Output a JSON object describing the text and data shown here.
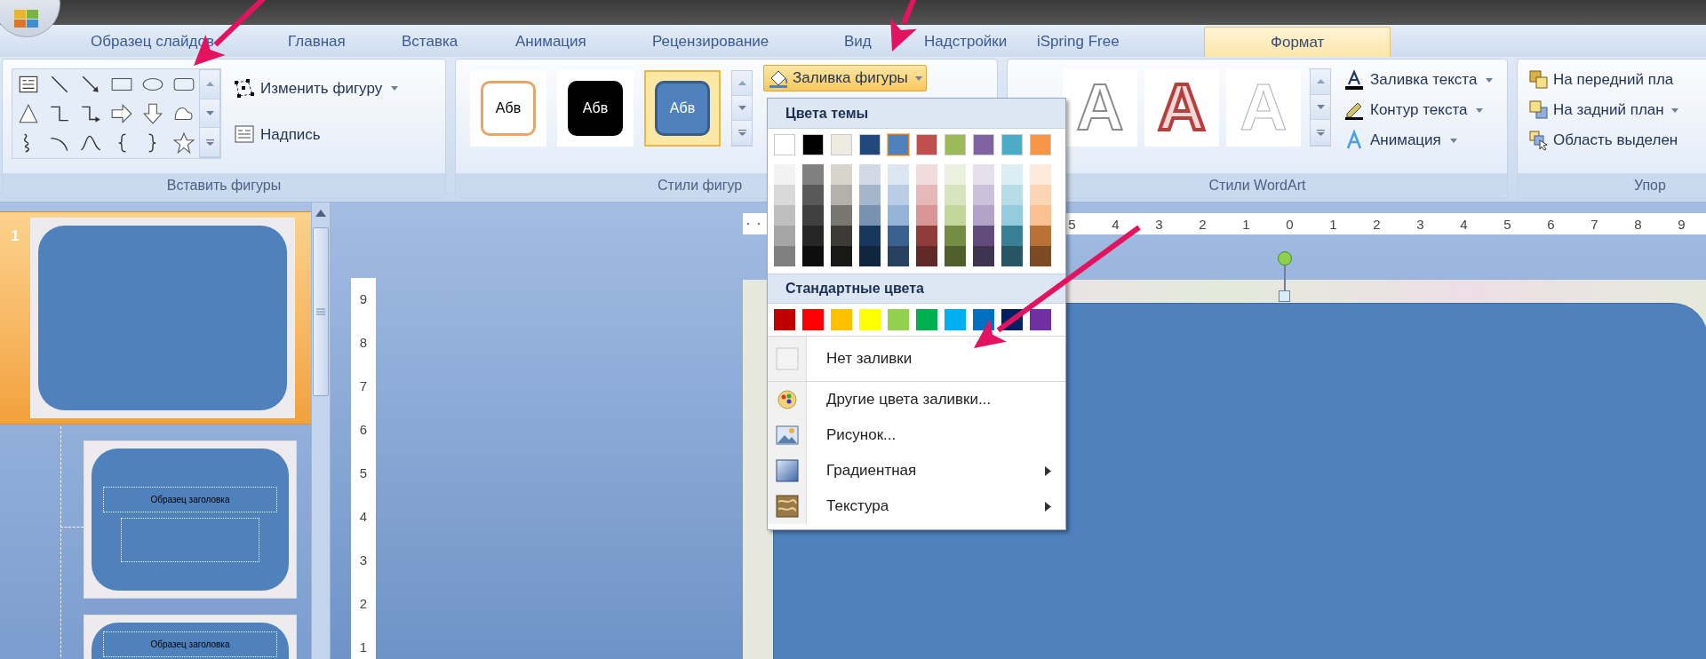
{
  "tabs": [
    {
      "label": "Образец слайдов",
      "selected": false
    },
    {
      "label": "Главная",
      "selected": false
    },
    {
      "label": "Вставка",
      "selected": false
    },
    {
      "label": "Анимация",
      "selected": false
    },
    {
      "label": "Рецензирование",
      "selected": false
    },
    {
      "label": "Вид",
      "selected": false
    },
    {
      "label": "Надстройки",
      "selected": false
    },
    {
      "label": "iSpring Free",
      "selected": false
    },
    {
      "label": "Формат",
      "selected": true
    }
  ],
  "insert_shapes": {
    "label": "Вставить фигуры",
    "buttons": [
      {
        "label": "Изменить фигуру",
        "kind": "edit-shape",
        "dropdown": true
      },
      {
        "label": "Надпись",
        "kind": "text-box",
        "dropdown": false
      }
    ]
  },
  "shape_styles": {
    "label": "Стили фигур",
    "styles": [
      {
        "text": "Абв",
        "kind": "outline",
        "selected": false
      },
      {
        "text": "Абв",
        "kind": "dark",
        "selected": false
      },
      {
        "text": "Абв",
        "kind": "blue",
        "selected": true
      }
    ],
    "fill_button": {
      "label": "Заливка фигуры",
      "open": true
    }
  },
  "wordart": {
    "label": "Стили WordArt",
    "styles": [
      {
        "text": "A",
        "kind": "outline"
      },
      {
        "text": "A",
        "kind": "red"
      },
      {
        "text": "A",
        "kind": "white"
      }
    ],
    "buttons": [
      {
        "label": "Заливка текста",
        "kind": "text-fill"
      },
      {
        "label": "Контур текста",
        "kind": "text-outline"
      },
      {
        "label": "Анимация",
        "kind": "animation"
      }
    ]
  },
  "arrange": {
    "label": "Упор",
    "buttons": [
      {
        "label": "На передний пла",
        "kind": "front",
        "dropdown": false
      },
      {
        "label": "На задний план",
        "kind": "back",
        "dropdown": true
      },
      {
        "label": "Область выделен",
        "kind": "selection",
        "dropdown": false
      }
    ]
  },
  "fill_menu": {
    "theme_header": "Цвета темы",
    "theme_colors": [
      {
        "color": "#ffffff",
        "selected": false
      },
      {
        "color": "#000000",
        "selected": false
      },
      {
        "color": "#eeece1",
        "selected": false
      },
      {
        "color": "#1f497d",
        "selected": false
      },
      {
        "color": "#4f81bd",
        "selected": true
      },
      {
        "color": "#c0504d",
        "selected": false
      },
      {
        "color": "#9bbb59",
        "selected": false
      },
      {
        "color": "#8064a2",
        "selected": false
      },
      {
        "color": "#4bacc6",
        "selected": false
      },
      {
        "color": "#f79646",
        "selected": false
      }
    ],
    "standard_header": "Стандартные цвета",
    "standard_colors": [
      {
        "color": "#c00000"
      },
      {
        "color": "#ff0000"
      },
      {
        "color": "#ffc000"
      },
      {
        "color": "#ffff00"
      },
      {
        "color": "#92d050"
      },
      {
        "color": "#00b050"
      },
      {
        "color": "#00b0f0"
      },
      {
        "color": "#0070c0"
      },
      {
        "color": "#002060"
      },
      {
        "color": "#7030a0"
      }
    ],
    "items": [
      {
        "label": "Нет заливки",
        "kind": "none",
        "submenu": false
      },
      {
        "label": "Другие цвета заливки...",
        "kind": "more-colors",
        "submenu": false
      },
      {
        "label": "Рисунок...",
        "kind": "picture",
        "submenu": false
      },
      {
        "label": "Градиентная",
        "kind": "gradient",
        "submenu": true
      },
      {
        "label": "Текстура",
        "kind": "texture",
        "submenu": true
      }
    ]
  },
  "slides": [
    {
      "number": "1",
      "kind": "master",
      "selected": true
    },
    {
      "kind": "layout",
      "title": "Образец заголовка",
      "selected": false
    },
    {
      "kind": "title-only",
      "title": "Образец заголовка",
      "selected": false
    }
  ],
  "h_ruler": [
    "5",
    "4",
    "3",
    "2",
    "1",
    "0",
    "1",
    "2",
    "3",
    "4",
    "5",
    "6",
    "7",
    "8",
    "9"
  ],
  "v_ruler": [
    "9",
    "8",
    "7",
    "6",
    "5",
    "4",
    "3",
    "2",
    "1"
  ]
}
